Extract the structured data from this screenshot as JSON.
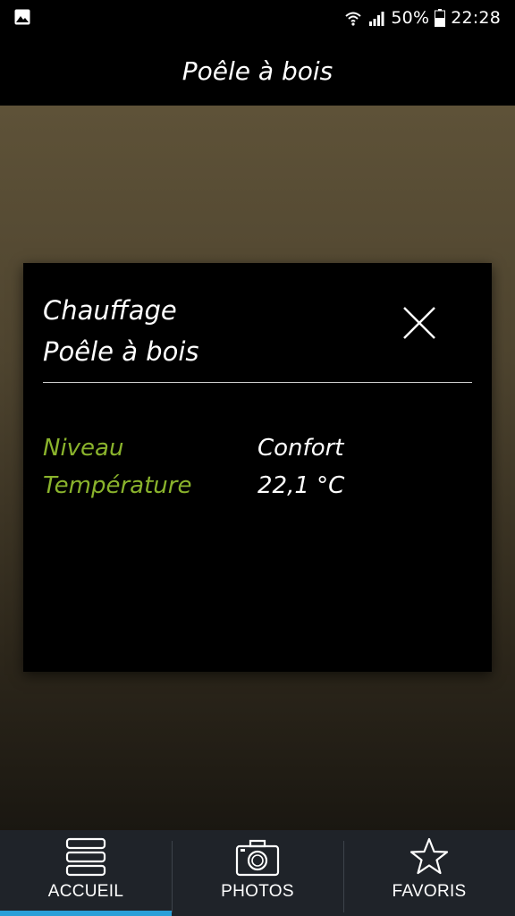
{
  "status_bar": {
    "battery": "50%",
    "time": "22:28",
    "icons": [
      "gallery-icon",
      "wifi-icon",
      "signal-icon",
      "battery-icon"
    ]
  },
  "header": {
    "title": "Poêle à bois"
  },
  "dialog": {
    "title_line1": "Chauffage",
    "title_line2": "Poêle à bois",
    "close_icon": "close-icon",
    "rows": [
      {
        "label": "Niveau",
        "value": "Confort"
      },
      {
        "label": "Température",
        "value": "22,1 °C"
      }
    ],
    "label_color": "#8ab32c"
  },
  "bottom_nav": {
    "items": [
      {
        "label": "ACCUEIL",
        "icon": "stack-icon",
        "active": true
      },
      {
        "label": "PHOTOS",
        "icon": "camera-icon",
        "active": false
      },
      {
        "label": "FAVORIS",
        "icon": "star-icon",
        "active": false
      }
    ],
    "active_color": "#2a9fd8"
  }
}
